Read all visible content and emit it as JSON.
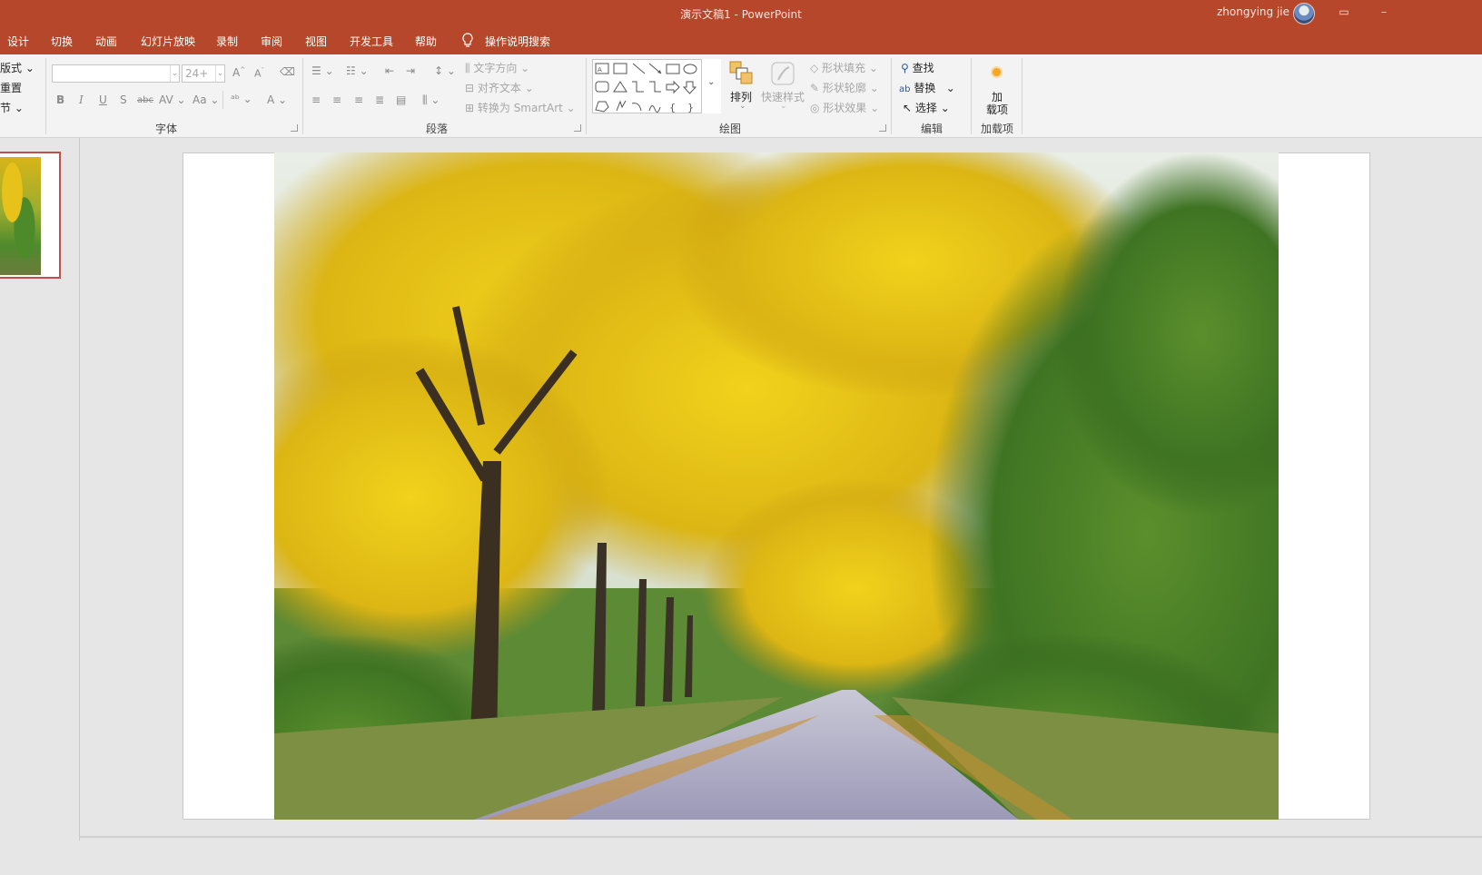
{
  "window": {
    "title": "演示文稿1  -  PowerPoint",
    "user": "zhongying jie"
  },
  "menu": {
    "tabs": [
      "设计",
      "切换",
      "动画",
      "幻灯片放映",
      "录制",
      "审阅",
      "视图",
      "开发工具",
      "帮助"
    ],
    "search_label": "操作说明搜索"
  },
  "ribbon": {
    "slides_group": {
      "layout": "版式",
      "reset": "重置",
      "section": "节"
    },
    "font_group": {
      "label": "字体",
      "font_name": "",
      "font_size": "24+",
      "grow": "A",
      "shrink": "A",
      "bold": "B",
      "italic": "I",
      "underline": "U",
      "shadow": "S",
      "strike": "abc",
      "spacing": "AV",
      "case": "Aa",
      "color": "A"
    },
    "paragraph_group": {
      "label": "段落",
      "text_direction": "文字方向",
      "align_text": "对齐文本",
      "convert_smartart": "转换为 SmartArt"
    },
    "drawing_group": {
      "label": "绘图",
      "arrange": "排列",
      "quick_styles": "快速样式",
      "shape_fill": "形状填充",
      "shape_outline": "形状轮廓",
      "shape_effects": "形状效果"
    },
    "editing_group": {
      "label": "编辑",
      "find": "查找",
      "replace": "替换",
      "select": "选择"
    },
    "addins_group": {
      "label": "加载项",
      "button_line1": "加",
      "button_line2": "载项"
    }
  },
  "colors": {
    "accent": "#b7472a",
    "selection": "#c0504d"
  }
}
